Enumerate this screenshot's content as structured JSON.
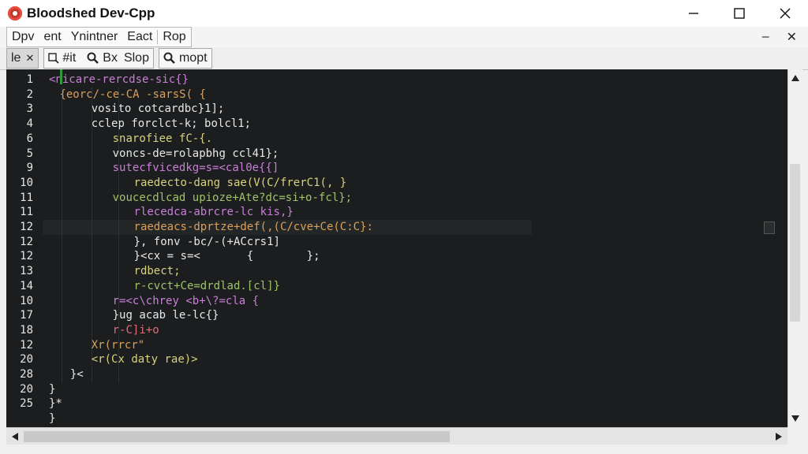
{
  "window": {
    "title": "Bloodshed Dev-Cpp",
    "controls": {
      "minimize": "minimize",
      "maximize": "maximize",
      "close": "close"
    }
  },
  "menubar": {
    "items": [
      "Dpv",
      "ent",
      "Ynintner",
      "Eact",
      "Rop"
    ],
    "mdi": {
      "minimize": "–",
      "close": "✕"
    }
  },
  "toolbar": {
    "tab_label": "le",
    "tab_close": "✕",
    "fit_label": "#it",
    "find_label": "Bx",
    "find_label2": "Slop",
    "import_label": "mopt"
  },
  "editor": {
    "lines": [
      {
        "num": "1",
        "indent": 0,
        "text": "<nicare-rercdse-sic{}",
        "cls": "c-br"
      },
      {
        "num": "2",
        "indent": 1,
        "text": "{eorc/-ce-CA -sarsS( {",
        "cls": "c-kw"
      },
      {
        "num": "3",
        "indent": 4,
        "text": "vosito cotcardbc}1];",
        "cls": "c-id"
      },
      {
        "num": "4",
        "indent": 4,
        "text": "cclep forclct-k; bolcl1;",
        "cls": "c-id"
      },
      {
        "num": "6",
        "indent": 6,
        "text": "snarofiee fC-{.",
        "cls": "c-str"
      },
      {
        "num": "5",
        "indent": 6,
        "text": "voncs-de=rolapbhg ccl41};",
        "cls": "c-id"
      },
      {
        "num": "9",
        "indent": 6,
        "text": "sutecfvicedkg=s=<cal0e{{]",
        "cls": "c-br"
      },
      {
        "num": "10",
        "indent": 8,
        "text": "raedecto-dang sae(V(C/frerC1(, }",
        "cls": "c-str"
      },
      {
        "num": "11",
        "indent": 6,
        "text": "voucecdlcad upioze+Ate?dc=si+o-fcl};",
        "cls": "c-num"
      },
      {
        "num": "11",
        "indent": 8,
        "text": "rlecedca-abrcre-lc kis,}",
        "cls": "c-br"
      },
      {
        "num": "12",
        "indent": 8,
        "text": "raedeacs-dprtze+def(,(C/cve+Ce(C:C}:",
        "cls": "c-kw",
        "hl": true
      },
      {
        "num": "12",
        "indent": 8,
        "text": "}, fonv -bc/-(+ACcrs1]",
        "cls": "c-id"
      },
      {
        "num": "12",
        "indent": 8,
        "text": "}<cx = s=<       {        };",
        "cls": "c-id"
      },
      {
        "num": "13",
        "indent": 8,
        "text": "rdbect;",
        "cls": "c-str"
      },
      {
        "num": "14",
        "indent": 8,
        "text": "r-cvct+Ce=drdlad.[cl]}",
        "cls": "c-num"
      },
      {
        "num": "10",
        "indent": 6,
        "text": "r=<c\\chrey <b+\\?=cla {",
        "cls": "c-br"
      },
      {
        "num": "17",
        "indent": 6,
        "text": "}ug acab le-lc{}",
        "cls": "c-id"
      },
      {
        "num": "18",
        "indent": 6,
        "text": "r-C]i+o",
        "cls": "c-op"
      },
      {
        "num": "12",
        "indent": 4,
        "text": "Xr(rrcr\"",
        "cls": "c-kw"
      },
      {
        "num": "20",
        "indent": 4,
        "text": "<r(Cx daty rae)>",
        "cls": "c-str"
      },
      {
        "num": "28",
        "indent": 2,
        "text": "}<",
        "cls": "c-id"
      },
      {
        "num": "20",
        "indent": 0,
        "text": "}",
        "cls": "c-id"
      },
      {
        "num": "25",
        "indent": 0,
        "text": "}*",
        "cls": "c-id"
      },
      {
        "num": "",
        "indent": 0,
        "text": "}",
        "cls": "c-id"
      }
    ]
  },
  "colors": {
    "editor_bg": "#1b1d1e",
    "fold_marker": "#2f9a3a",
    "titlebar_bg": "#ffffff",
    "chrome_bg": "#f0f0f0"
  }
}
